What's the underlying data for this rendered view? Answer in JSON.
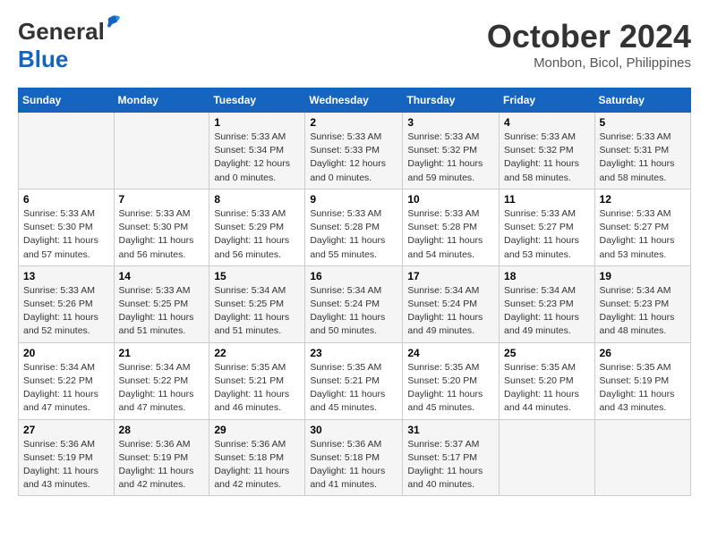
{
  "header": {
    "logo_line1": "General",
    "logo_line2": "Blue",
    "month": "October 2024",
    "location": "Monbon, Bicol, Philippines"
  },
  "weekdays": [
    "Sunday",
    "Monday",
    "Tuesday",
    "Wednesday",
    "Thursday",
    "Friday",
    "Saturday"
  ],
  "weeks": [
    [
      {
        "day": "",
        "info": ""
      },
      {
        "day": "",
        "info": ""
      },
      {
        "day": "1",
        "info": "Sunrise: 5:33 AM\nSunset: 5:34 PM\nDaylight: 12 hours\nand 0 minutes."
      },
      {
        "day": "2",
        "info": "Sunrise: 5:33 AM\nSunset: 5:33 PM\nDaylight: 12 hours\nand 0 minutes."
      },
      {
        "day": "3",
        "info": "Sunrise: 5:33 AM\nSunset: 5:32 PM\nDaylight: 11 hours\nand 59 minutes."
      },
      {
        "day": "4",
        "info": "Sunrise: 5:33 AM\nSunset: 5:32 PM\nDaylight: 11 hours\nand 58 minutes."
      },
      {
        "day": "5",
        "info": "Sunrise: 5:33 AM\nSunset: 5:31 PM\nDaylight: 11 hours\nand 58 minutes."
      }
    ],
    [
      {
        "day": "6",
        "info": "Sunrise: 5:33 AM\nSunset: 5:30 PM\nDaylight: 11 hours\nand 57 minutes."
      },
      {
        "day": "7",
        "info": "Sunrise: 5:33 AM\nSunset: 5:30 PM\nDaylight: 11 hours\nand 56 minutes."
      },
      {
        "day": "8",
        "info": "Sunrise: 5:33 AM\nSunset: 5:29 PM\nDaylight: 11 hours\nand 56 minutes."
      },
      {
        "day": "9",
        "info": "Sunrise: 5:33 AM\nSunset: 5:28 PM\nDaylight: 11 hours\nand 55 minutes."
      },
      {
        "day": "10",
        "info": "Sunrise: 5:33 AM\nSunset: 5:28 PM\nDaylight: 11 hours\nand 54 minutes."
      },
      {
        "day": "11",
        "info": "Sunrise: 5:33 AM\nSunset: 5:27 PM\nDaylight: 11 hours\nand 53 minutes."
      },
      {
        "day": "12",
        "info": "Sunrise: 5:33 AM\nSunset: 5:27 PM\nDaylight: 11 hours\nand 53 minutes."
      }
    ],
    [
      {
        "day": "13",
        "info": "Sunrise: 5:33 AM\nSunset: 5:26 PM\nDaylight: 11 hours\nand 52 minutes."
      },
      {
        "day": "14",
        "info": "Sunrise: 5:33 AM\nSunset: 5:25 PM\nDaylight: 11 hours\nand 51 minutes."
      },
      {
        "day": "15",
        "info": "Sunrise: 5:34 AM\nSunset: 5:25 PM\nDaylight: 11 hours\nand 51 minutes."
      },
      {
        "day": "16",
        "info": "Sunrise: 5:34 AM\nSunset: 5:24 PM\nDaylight: 11 hours\nand 50 minutes."
      },
      {
        "day": "17",
        "info": "Sunrise: 5:34 AM\nSunset: 5:24 PM\nDaylight: 11 hours\nand 49 minutes."
      },
      {
        "day": "18",
        "info": "Sunrise: 5:34 AM\nSunset: 5:23 PM\nDaylight: 11 hours\nand 49 minutes."
      },
      {
        "day": "19",
        "info": "Sunrise: 5:34 AM\nSunset: 5:23 PM\nDaylight: 11 hours\nand 48 minutes."
      }
    ],
    [
      {
        "day": "20",
        "info": "Sunrise: 5:34 AM\nSunset: 5:22 PM\nDaylight: 11 hours\nand 47 minutes."
      },
      {
        "day": "21",
        "info": "Sunrise: 5:34 AM\nSunset: 5:22 PM\nDaylight: 11 hours\nand 47 minutes."
      },
      {
        "day": "22",
        "info": "Sunrise: 5:35 AM\nSunset: 5:21 PM\nDaylight: 11 hours\nand 46 minutes."
      },
      {
        "day": "23",
        "info": "Sunrise: 5:35 AM\nSunset: 5:21 PM\nDaylight: 11 hours\nand 45 minutes."
      },
      {
        "day": "24",
        "info": "Sunrise: 5:35 AM\nSunset: 5:20 PM\nDaylight: 11 hours\nand 45 minutes."
      },
      {
        "day": "25",
        "info": "Sunrise: 5:35 AM\nSunset: 5:20 PM\nDaylight: 11 hours\nand 44 minutes."
      },
      {
        "day": "26",
        "info": "Sunrise: 5:35 AM\nSunset: 5:19 PM\nDaylight: 11 hours\nand 43 minutes."
      }
    ],
    [
      {
        "day": "27",
        "info": "Sunrise: 5:36 AM\nSunset: 5:19 PM\nDaylight: 11 hours\nand 43 minutes."
      },
      {
        "day": "28",
        "info": "Sunrise: 5:36 AM\nSunset: 5:19 PM\nDaylight: 11 hours\nand 42 minutes."
      },
      {
        "day": "29",
        "info": "Sunrise: 5:36 AM\nSunset: 5:18 PM\nDaylight: 11 hours\nand 42 minutes."
      },
      {
        "day": "30",
        "info": "Sunrise: 5:36 AM\nSunset: 5:18 PM\nDaylight: 11 hours\nand 41 minutes."
      },
      {
        "day": "31",
        "info": "Sunrise: 5:37 AM\nSunset: 5:17 PM\nDaylight: 11 hours\nand 40 minutes."
      },
      {
        "day": "",
        "info": ""
      },
      {
        "day": "",
        "info": ""
      }
    ]
  ]
}
